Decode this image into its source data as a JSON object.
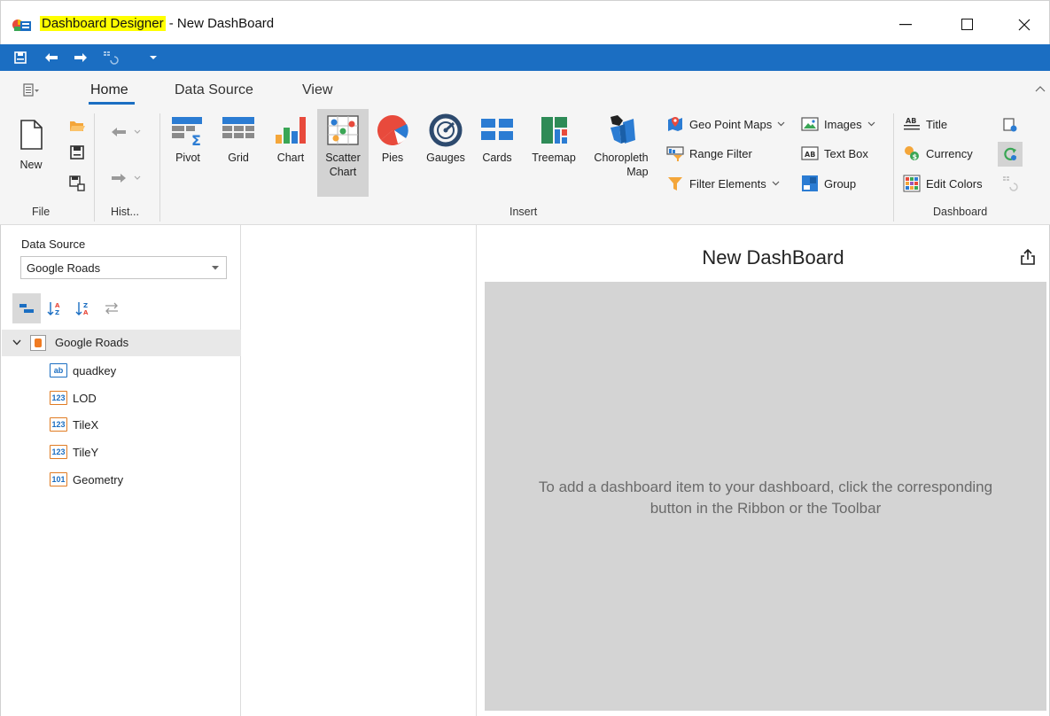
{
  "window": {
    "title_highlight": "Dashboard Designer",
    "title_rest": " - New DashBoard",
    "minimize": "—",
    "maximize": "☐",
    "close": "✕"
  },
  "ribbon": {
    "tabs": [
      {
        "label": "Home",
        "active": true
      },
      {
        "label": "Data Source",
        "active": false
      },
      {
        "label": "View",
        "active": false
      }
    ],
    "file": {
      "new_label": "New",
      "group_label": "File"
    },
    "history": {
      "group_label": "Hist..."
    },
    "insert": {
      "buttons": [
        {
          "label": "Pivot",
          "icon": "pivot-icon"
        },
        {
          "label": "Grid",
          "icon": "grid-icon"
        },
        {
          "label": "Chart",
          "icon": "chart-icon"
        },
        {
          "label": "Scatter\nChart",
          "icon": "scatter-chart-icon",
          "selected": true
        },
        {
          "label": "Pies",
          "icon": "pies-icon"
        },
        {
          "label": "Gauges",
          "icon": "gauges-icon"
        },
        {
          "label": "Cards",
          "icon": "cards-icon"
        },
        {
          "label": "Treemap",
          "icon": "treemap-icon"
        },
        {
          "label": "Choropleth\nMap",
          "icon": "choropleth-map-icon"
        }
      ],
      "small": {
        "geo_point_maps": "Geo Point Maps",
        "range_filter": "Range Filter",
        "filter_elements": "Filter Elements",
        "images": "Images",
        "text_box": "Text Box",
        "group": "Group"
      },
      "group_label": "Insert"
    },
    "dashboard": {
      "title": "Title",
      "currency": "Currency",
      "edit_colors": "Edit Colors",
      "group_label": "Dashboard"
    }
  },
  "data_source_panel": {
    "label": "Data Source",
    "selected": "Google Roads",
    "tree": {
      "root": "Google Roads",
      "fields": [
        {
          "name": "quadkey",
          "type": "ab"
        },
        {
          "name": "LOD",
          "type": "123"
        },
        {
          "name": "TileX",
          "type": "123"
        },
        {
          "name": "TileY",
          "type": "123"
        },
        {
          "name": "Geometry",
          "type": "101"
        }
      ]
    }
  },
  "canvas": {
    "title": "New DashBoard",
    "empty_message_line1": "To add a dashboard item to your dashboard, click the corresponding",
    "empty_message_line2": "button in the Ribbon or the Toolbar"
  },
  "colors": {
    "accent": "#1b6ec2",
    "title_highlight": "#ffff00",
    "drop_zone": "#d4d4d4"
  }
}
